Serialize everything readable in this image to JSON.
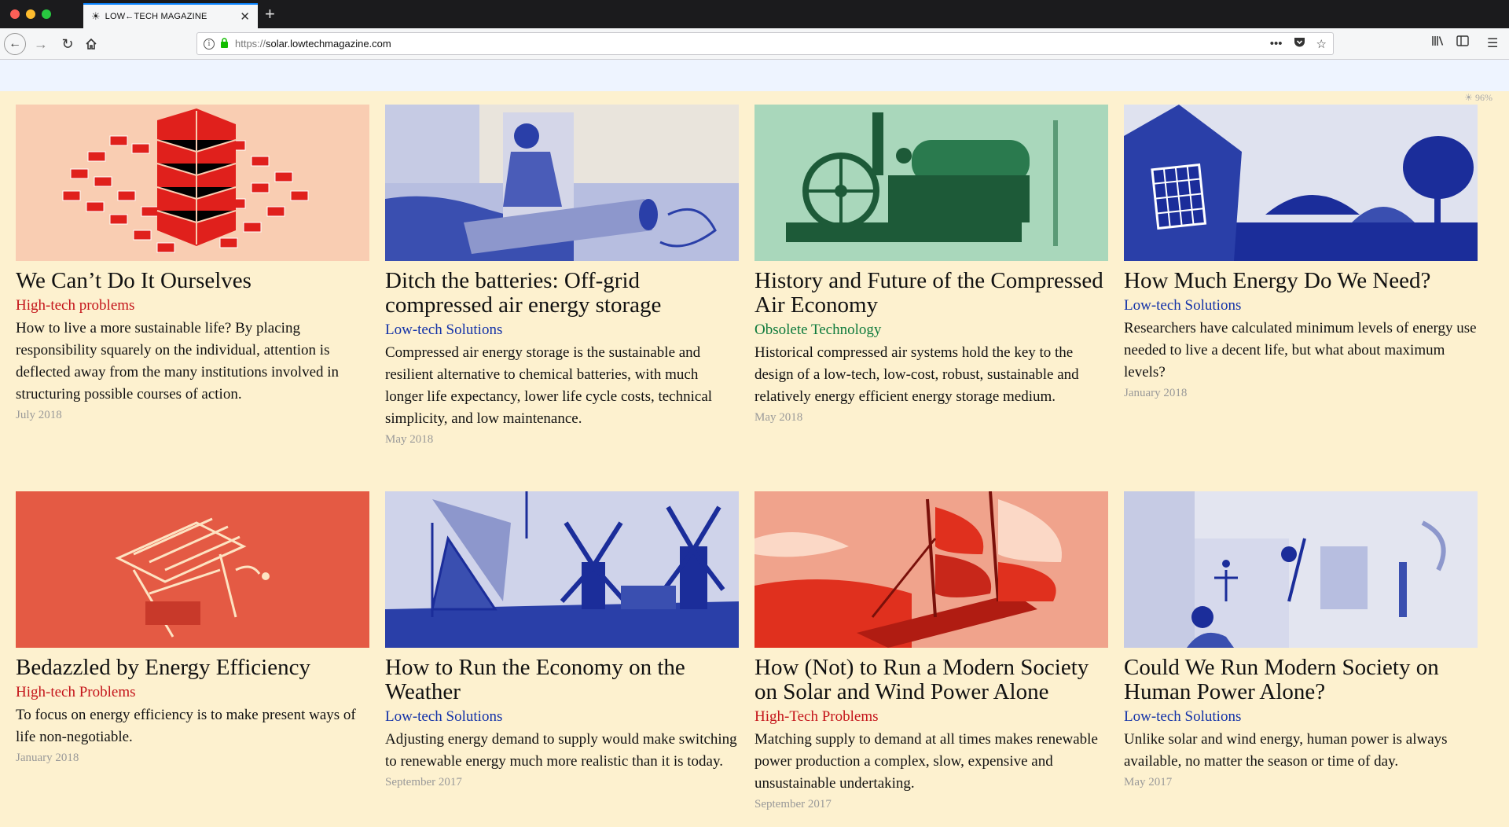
{
  "browser": {
    "tab_title": "LOW←TECH MAGAZINE",
    "url_scheme": "https://",
    "url_host": "solar.lowtechmagazine.com"
  },
  "page": {
    "battery_level": "96%"
  },
  "articles": [
    {
      "title": "We Can’t Do It Ourselves",
      "category": "High-tech problems",
      "category_color": "#c4141a",
      "description": "How to live a more sustainable life? By placing responsibility squarely on the individual, attention is deflected away from the many institutions involved in structuring possible courses of action.",
      "date": "July 2018",
      "image_tint": "#e0201c"
    },
    {
      "title": "Ditch the batteries: Off-grid compressed air energy storage",
      "category": "Low-tech Solutions",
      "category_color": "#1332a8",
      "description": "Compressed air energy storage is the sustainable and resilient alternative to chemical batteries, with much longer life expectancy, lower life cycle costs, technical simplicity, and low maintenance.",
      "date": "May 2018",
      "image_tint": "#2a3fa8"
    },
    {
      "title": "History and Future of the Compressed Air Economy",
      "category": "Obsolete Technology",
      "category_color": "#0e7a3c",
      "description": "Historical compressed air systems hold the key to the design of a low-tech, low-cost, robust, sustainable and relatively energy efficient energy storage medium.",
      "date": "May 2018",
      "image_tint": "#1d7a4a"
    },
    {
      "title": "How Much Energy Do We Need?",
      "category": "Low-tech Solutions",
      "category_color": "#1332a8",
      "description": "Researchers have calculated minimum levels of energy use needed to live a decent life, but what about maximum levels?",
      "date": "January 2018",
      "image_tint": "#1b2d9a"
    },
    {
      "title": "Bedazzled by Energy Efficiency",
      "category": "High-tech Problems",
      "category_color": "#c4141a",
      "description": "To focus on energy efficiency is to make present ways of life non-negotiable.",
      "date": "January 2018",
      "image_tint": "#e45a44"
    },
    {
      "title": "How to Run the Economy on the Weather",
      "category": "Low-tech Solutions",
      "category_color": "#1332a8",
      "description": "Adjusting energy demand to supply would make switching to renewable energy much more realistic than it is today.",
      "date": "September 2017",
      "image_tint": "#2a3fa8"
    },
    {
      "title": "How (Not) to Run a Modern Society on Solar and Wind Power Alone",
      "category": "High-Tech Problems",
      "category_color": "#c4141a",
      "description": "Matching supply to demand at all times makes renewable power production a complex, slow, expensive and unsustainable undertaking.",
      "date": "September 2017",
      "image_tint": "#e0301e"
    },
    {
      "title": "Could We Run Modern Society on Human Power Alone?",
      "category": "Low-tech Solutions",
      "category_color": "#1332a8",
      "description": "Unlike solar and wind energy, human power is always available, no matter the season or time of day.",
      "date": "May 2017",
      "image_tint": "#3a4fb0"
    }
  ]
}
